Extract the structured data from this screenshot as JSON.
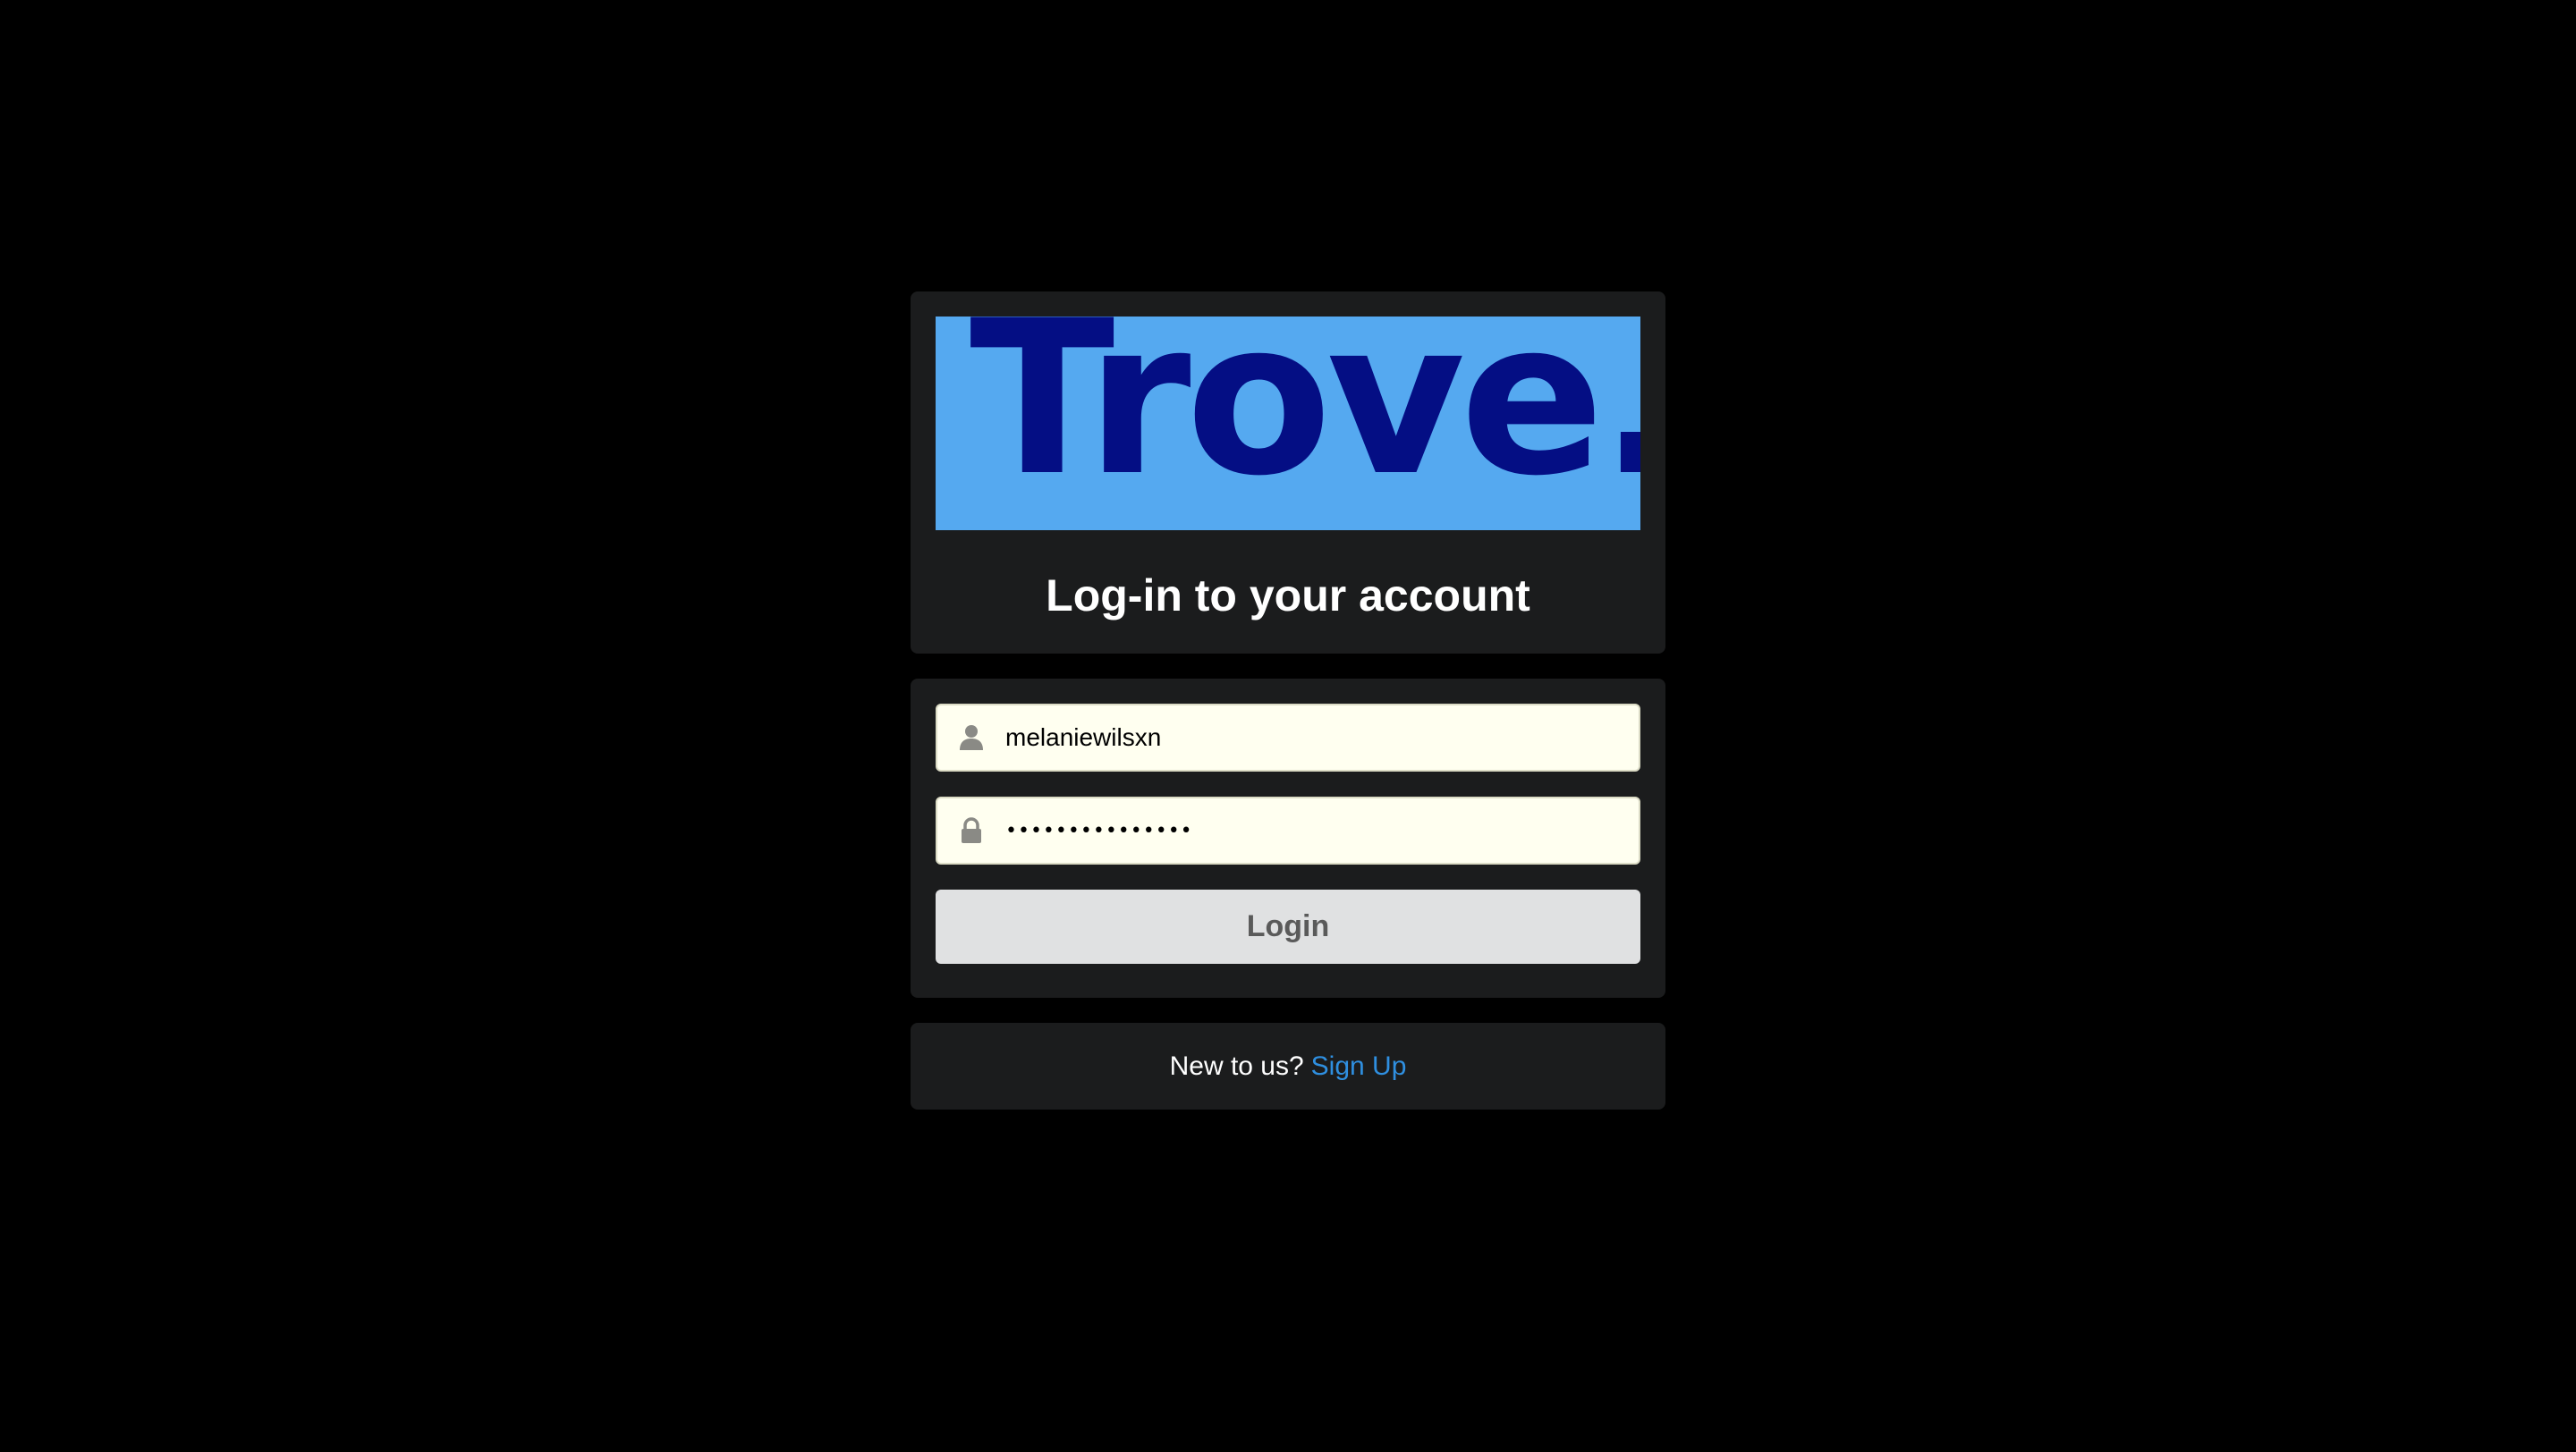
{
  "logo": {
    "text": "Trove.",
    "background": "#55a9f0",
    "color": "#040e84"
  },
  "header": {
    "title": "Log-in to your account"
  },
  "form": {
    "username": {
      "value": "melaniewilsxn",
      "icon": "user-icon"
    },
    "password": {
      "value": "•••••••••••••••",
      "icon": "lock-icon"
    },
    "login_label": "Login"
  },
  "footer": {
    "prompt": "New to us?",
    "signup_label": "Sign Up",
    "link_color": "#2f8fe0"
  }
}
